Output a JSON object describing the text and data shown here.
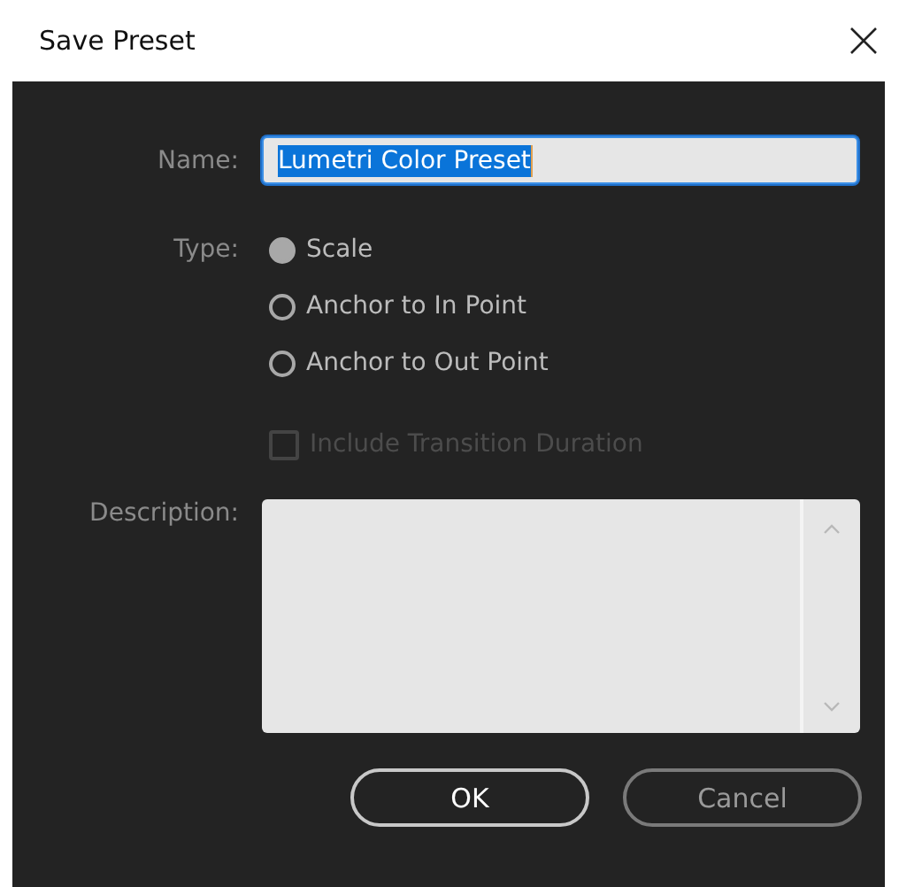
{
  "window": {
    "title": "Save Preset"
  },
  "name": {
    "label": "Name:",
    "value": "Lumetri Color Preset",
    "text_selected": true
  },
  "type": {
    "label": "Type:",
    "options": [
      {
        "label": "Scale",
        "selected": true
      },
      {
        "label": "Anchor to In Point",
        "selected": false
      },
      {
        "label": "Anchor to Out Point",
        "selected": false
      }
    ]
  },
  "include_transition_duration": {
    "label": "Include Transition Duration",
    "checked": false,
    "disabled": true
  },
  "description": {
    "label": "Description:"
  },
  "buttons": [
    {
      "label": "OK",
      "default": true
    },
    {
      "label": "Cancel",
      "default": false
    }
  ]
}
